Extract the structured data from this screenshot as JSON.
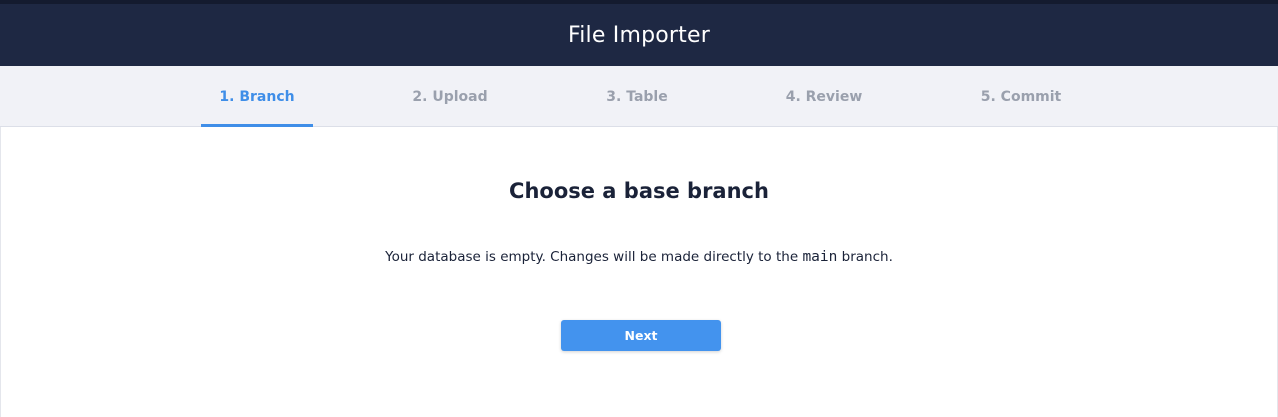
{
  "header": {
    "title": "File Importer"
  },
  "steps": [
    {
      "label": "1. Branch",
      "active": true
    },
    {
      "label": "2. Upload",
      "active": false
    },
    {
      "label": "3. Table",
      "active": false
    },
    {
      "label": "4. Review",
      "active": false
    },
    {
      "label": "5. Commit",
      "active": false
    }
  ],
  "main": {
    "title": "Choose a base branch",
    "message_before": "Your database is empty. Changes will be made directly to the ",
    "branch_name": "main",
    "message_after": " branch.",
    "next_label": "Next"
  },
  "colors": {
    "header_bg": "#1e2843",
    "accent": "#3f8ee8",
    "button": "#4393ee",
    "inactive_step": "#9aa0ad"
  }
}
